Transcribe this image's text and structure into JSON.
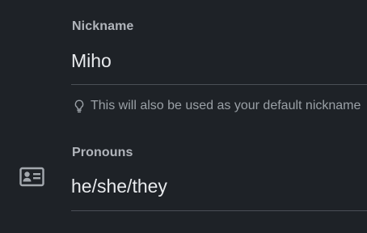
{
  "nickname": {
    "label": "Nickname",
    "value": "Miho",
    "hint": "This will also be used as your default nickname",
    "hint_icon": "lightbulb-icon"
  },
  "pronouns": {
    "label": "Pronouns",
    "value": "he/she/they",
    "icon": "id-card-icon"
  },
  "colors": {
    "background": "#1e2227",
    "label": "#b1b5bb",
    "value": "#e8eaed",
    "hint": "#9aa0a6",
    "underline": "#4a4f56"
  }
}
